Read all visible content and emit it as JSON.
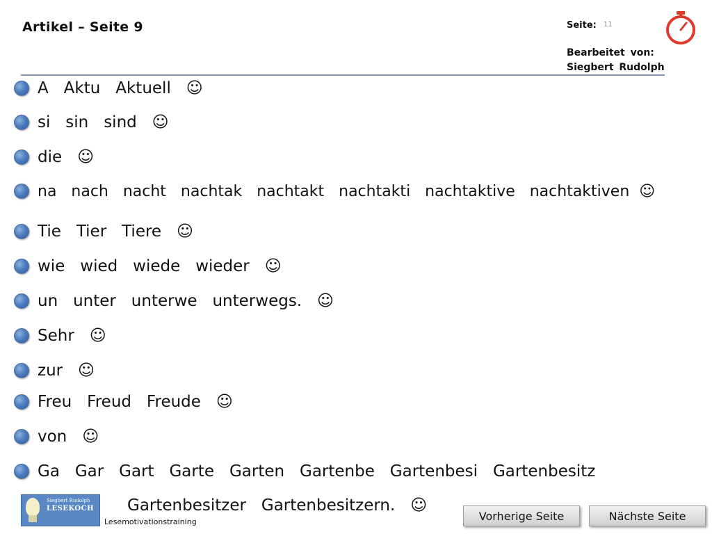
{
  "header": {
    "title": "Artikel – Seite 9",
    "page_label": "Seite:",
    "page_number": "11",
    "editor_label": "Bearbeitet von:",
    "editor_name": "Siegbert Rudolph",
    "timer_icon": "stopwatch-icon",
    "rule_color": "#7f96b8"
  },
  "lines": [
    "A   Aktu   Aktuell   ☺",
    "si   sin   sind   ☺",
    "die   ☺",
    "na   nach   nacht   nachtak   nachtakt   nachtakti   nachtaktive   nachtaktiven  ☺",
    "Tie   Tier   Tiere   ☺",
    "wie   wied   wiede   wieder   ☺",
    "un   unter   unterwe   unterwegs.   ☺",
    "Sehr   ☺",
    "zur   ☺",
    "Freu   Freud   Freude   ☺",
    "von   ☺",
    "Ga   Gar   Gart   Garte   Garten   Gartenbe   Gartenbesi   Gartenbesitz"
  ],
  "continuation_line": "Gartenbesitzer   Gartenbesitzern.   ☺",
  "footer": {
    "logo_small": "Siegbert Rudolph",
    "logo_big": "LESEKOCH",
    "caption": "Lesemotivationstraining",
    "prev_button": "Vorherige Seite",
    "next_button": "Nächste Seite"
  },
  "colors": {
    "bullet": "#4f7ec0",
    "timer": "#e03a2a"
  }
}
